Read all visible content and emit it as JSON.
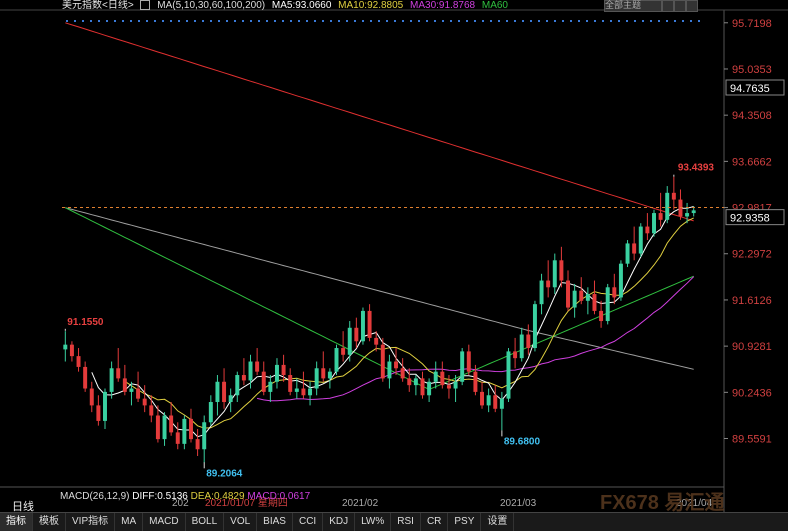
{
  "header": {
    "symbol": "美元指数<日线>",
    "ma_params": "MA(5,10,30,60,100,200)",
    "ma5": "MA5:93.0660",
    "ma10": "MA10:92.8805",
    "ma30": "MA30:91.8768",
    "ma60": "MA60",
    "main_menu": "全部主题"
  },
  "colors": {
    "up": "#3ad0a0",
    "down": "#e43b3b",
    "ma5": "#ffffff",
    "ma10": "#e0d040",
    "ma30": "#d040e0",
    "ma60": "#30c040",
    "ma100": "#a0a0a0",
    "ma200": "#e03030",
    "axis_text": "#d04040"
  },
  "macd": {
    "label": "MACD(26,12,9)",
    "diff": "DIFF:0.5136",
    "dea": "DEA:0.4829",
    "macd": "MACD:0.0617"
  },
  "daily_label": "日线",
  "bottom_tabs": [
    "指标",
    "模板",
    "VIP指标",
    "MA",
    "MACD",
    "BOLL",
    "VOL",
    "BIAS",
    "CCI",
    "KDJ",
    "LW%",
    "RSI",
    "CR",
    "PSY",
    "设置"
  ],
  "watermark": "FX678 易汇通",
  "chart_data": {
    "type": "candlestick",
    "y_ticks": [
      95.7198,
      95.0353,
      94.3508,
      93.6662,
      92.9817,
      92.2972,
      91.6126,
      90.9281,
      90.2436,
      89.5591
    ],
    "y_range": [
      89.3,
      95.85
    ],
    "x_labels": [
      "202",
      "2021/01/07 星期四",
      "2021/02",
      "2021/03",
      "2021/04"
    ],
    "current_price": "92.9358",
    "crosshair_price": "94.7635",
    "annotations": [
      {
        "text": "91.1550",
        "index": 0,
        "price": 91.155
      },
      {
        "text": "89.2064",
        "index": 21,
        "price": 89.2064
      },
      {
        "text": "89.6800",
        "index": 66,
        "price": 89.68
      },
      {
        "text": "93.4393",
        "index": 92,
        "price": 93.4393
      }
    ],
    "candles": [
      {
        "o": 90.88,
        "h": 91.15,
        "l": 90.7,
        "c": 90.95
      },
      {
        "o": 90.95,
        "h": 91.0,
        "l": 90.7,
        "c": 90.78
      },
      {
        "o": 90.78,
        "h": 90.9,
        "l": 90.55,
        "c": 90.62
      },
      {
        "o": 90.62,
        "h": 90.7,
        "l": 90.25,
        "c": 90.3
      },
      {
        "o": 90.3,
        "h": 90.4,
        "l": 89.95,
        "c": 90.05
      },
      {
        "o": 90.05,
        "h": 90.2,
        "l": 89.75,
        "c": 89.82
      },
      {
        "o": 89.82,
        "h": 90.3,
        "l": 89.7,
        "c": 90.25
      },
      {
        "o": 90.25,
        "h": 90.7,
        "l": 90.15,
        "c": 90.6
      },
      {
        "o": 90.6,
        "h": 90.9,
        "l": 90.4,
        "c": 90.45
      },
      {
        "o": 90.45,
        "h": 90.65,
        "l": 90.2,
        "c": 90.25
      },
      {
        "o": 90.25,
        "h": 90.4,
        "l": 90.05,
        "c": 90.3
      },
      {
        "o": 90.3,
        "h": 90.55,
        "l": 90.1,
        "c": 90.15
      },
      {
        "o": 90.15,
        "h": 90.35,
        "l": 89.95,
        "c": 90.05
      },
      {
        "o": 90.05,
        "h": 90.2,
        "l": 89.8,
        "c": 89.9
      },
      {
        "o": 89.9,
        "h": 90.05,
        "l": 89.5,
        "c": 89.55
      },
      {
        "o": 89.55,
        "h": 89.95,
        "l": 89.45,
        "c": 89.9
      },
      {
        "o": 89.9,
        "h": 90.1,
        "l": 89.6,
        "c": 89.65
      },
      {
        "o": 89.65,
        "h": 89.8,
        "l": 89.4,
        "c": 89.48
      },
      {
        "o": 89.48,
        "h": 89.9,
        "l": 89.4,
        "c": 89.85
      },
      {
        "o": 89.85,
        "h": 90.0,
        "l": 89.5,
        "c": 89.55
      },
      {
        "o": 89.55,
        "h": 89.7,
        "l": 89.3,
        "c": 89.4
      },
      {
        "o": 89.4,
        "h": 89.9,
        "l": 89.2,
        "c": 89.8
      },
      {
        "o": 89.8,
        "h": 90.2,
        "l": 89.75,
        "c": 90.1
      },
      {
        "o": 90.1,
        "h": 90.5,
        "l": 89.9,
        "c": 90.4
      },
      {
        "o": 90.4,
        "h": 90.6,
        "l": 90.0,
        "c": 90.1
      },
      {
        "o": 90.1,
        "h": 90.3,
        "l": 89.95,
        "c": 90.2
      },
      {
        "o": 90.2,
        "h": 90.55,
        "l": 90.1,
        "c": 90.5
      },
      {
        "o": 90.5,
        "h": 90.75,
        "l": 90.35,
        "c": 90.42
      },
      {
        "o": 90.42,
        "h": 90.8,
        "l": 90.3,
        "c": 90.7
      },
      {
        "o": 90.7,
        "h": 90.9,
        "l": 90.5,
        "c": 90.55
      },
      {
        "o": 90.55,
        "h": 90.7,
        "l": 90.2,
        "c": 90.25
      },
      {
        "o": 90.25,
        "h": 90.5,
        "l": 90.1,
        "c": 90.4
      },
      {
        "o": 90.4,
        "h": 90.75,
        "l": 90.3,
        "c": 90.65
      },
      {
        "o": 90.65,
        "h": 90.8,
        "l": 90.4,
        "c": 90.5
      },
      {
        "o": 90.5,
        "h": 90.6,
        "l": 90.2,
        "c": 90.25
      },
      {
        "o": 90.25,
        "h": 90.45,
        "l": 90.15,
        "c": 90.3
      },
      {
        "o": 90.3,
        "h": 90.55,
        "l": 90.15,
        "c": 90.2
      },
      {
        "o": 90.2,
        "h": 90.4,
        "l": 90.05,
        "c": 90.3
      },
      {
        "o": 90.3,
        "h": 90.7,
        "l": 90.2,
        "c": 90.6
      },
      {
        "o": 90.6,
        "h": 90.85,
        "l": 90.4,
        "c": 90.45
      },
      {
        "o": 90.45,
        "h": 90.6,
        "l": 90.3,
        "c": 90.55
      },
      {
        "o": 90.55,
        "h": 90.95,
        "l": 90.5,
        "c": 90.9
      },
      {
        "o": 90.9,
        "h": 91.15,
        "l": 90.7,
        "c": 90.8
      },
      {
        "o": 90.8,
        "h": 91.3,
        "l": 90.7,
        "c": 91.2
      },
      {
        "o": 91.2,
        "h": 91.35,
        "l": 90.9,
        "c": 91.0
      },
      {
        "o": 91.0,
        "h": 91.5,
        "l": 90.95,
        "c": 91.45
      },
      {
        "o": 91.45,
        "h": 91.55,
        "l": 91.0,
        "c": 91.05
      },
      {
        "o": 91.05,
        "h": 91.15,
        "l": 90.85,
        "c": 90.95
      },
      {
        "o": 90.95,
        "h": 91.05,
        "l": 90.4,
        "c": 90.45
      },
      {
        "o": 90.45,
        "h": 90.8,
        "l": 90.3,
        "c": 90.7
      },
      {
        "o": 90.7,
        "h": 90.9,
        "l": 90.5,
        "c": 90.6
      },
      {
        "o": 90.6,
        "h": 90.75,
        "l": 90.4,
        "c": 90.45
      },
      {
        "o": 90.45,
        "h": 90.6,
        "l": 90.25,
        "c": 90.35
      },
      {
        "o": 90.35,
        "h": 90.5,
        "l": 90.2,
        "c": 90.45
      },
      {
        "o": 90.45,
        "h": 90.55,
        "l": 90.15,
        "c": 90.2
      },
      {
        "o": 90.2,
        "h": 90.45,
        "l": 90.1,
        "c": 90.4
      },
      {
        "o": 90.4,
        "h": 90.7,
        "l": 90.3,
        "c": 90.55
      },
      {
        "o": 90.55,
        "h": 90.7,
        "l": 90.3,
        "c": 90.35
      },
      {
        "o": 90.35,
        "h": 90.5,
        "l": 90.15,
        "c": 90.3
      },
      {
        "o": 90.3,
        "h": 90.5,
        "l": 90.1,
        "c": 90.4
      },
      {
        "o": 90.4,
        "h": 90.9,
        "l": 90.35,
        "c": 90.85
      },
      {
        "o": 90.85,
        "h": 90.95,
        "l": 90.5,
        "c": 90.55
      },
      {
        "o": 90.55,
        "h": 90.65,
        "l": 90.2,
        "c": 90.25
      },
      {
        "o": 90.25,
        "h": 90.4,
        "l": 90.0,
        "c": 90.05
      },
      {
        "o": 90.05,
        "h": 90.3,
        "l": 89.95,
        "c": 90.2
      },
      {
        "o": 90.2,
        "h": 90.35,
        "l": 89.95,
        "c": 90.0
      },
      {
        "o": 90.0,
        "h": 90.25,
        "l": 89.68,
        "c": 90.15
      },
      {
        "o": 90.15,
        "h": 90.9,
        "l": 90.1,
        "c": 90.85
      },
      {
        "o": 90.85,
        "h": 91.05,
        "l": 90.6,
        "c": 90.75
      },
      {
        "o": 90.75,
        "h": 91.2,
        "l": 90.7,
        "c": 91.1
      },
      {
        "o": 91.1,
        "h": 91.25,
        "l": 90.8,
        "c": 90.9
      },
      {
        "o": 90.9,
        "h": 91.6,
        "l": 90.85,
        "c": 91.55
      },
      {
        "o": 91.55,
        "h": 92.0,
        "l": 91.4,
        "c": 91.9
      },
      {
        "o": 91.9,
        "h": 92.2,
        "l": 91.65,
        "c": 91.8
      },
      {
        "o": 91.8,
        "h": 92.3,
        "l": 91.7,
        "c": 92.2
      },
      {
        "o": 92.2,
        "h": 92.4,
        "l": 91.8,
        "c": 91.9
      },
      {
        "o": 91.9,
        "h": 92.05,
        "l": 91.45,
        "c": 91.5
      },
      {
        "o": 91.5,
        "h": 91.85,
        "l": 91.35,
        "c": 91.75
      },
      {
        "o": 91.75,
        "h": 91.95,
        "l": 91.55,
        "c": 91.6
      },
      {
        "o": 91.6,
        "h": 91.8,
        "l": 91.4,
        "c": 91.7
      },
      {
        "o": 91.7,
        "h": 91.9,
        "l": 91.4,
        "c": 91.45
      },
      {
        "o": 91.45,
        "h": 91.6,
        "l": 91.2,
        "c": 91.3
      },
      {
        "o": 91.3,
        "h": 91.85,
        "l": 91.25,
        "c": 91.8
      },
      {
        "o": 91.8,
        "h": 92.0,
        "l": 91.55,
        "c": 91.65
      },
      {
        "o": 91.65,
        "h": 92.2,
        "l": 91.6,
        "c": 92.15
      },
      {
        "o": 92.15,
        "h": 92.5,
        "l": 92.1,
        "c": 92.45
      },
      {
        "o": 92.45,
        "h": 92.7,
        "l": 92.2,
        "c": 92.3
      },
      {
        "o": 92.3,
        "h": 92.75,
        "l": 92.25,
        "c": 92.7
      },
      {
        "o": 92.7,
        "h": 92.9,
        "l": 92.5,
        "c": 92.6
      },
      {
        "o": 92.6,
        "h": 92.95,
        "l": 92.55,
        "c": 92.9
      },
      {
        "o": 92.9,
        "h": 93.2,
        "l": 92.7,
        "c": 92.8
      },
      {
        "o": 92.8,
        "h": 93.3,
        "l": 92.75,
        "c": 93.2
      },
      {
        "o": 93.2,
        "h": 93.44,
        "l": 92.95,
        "c": 93.1
      },
      {
        "o": 93.1,
        "h": 93.25,
        "l": 92.8,
        "c": 92.85
      },
      {
        "o": 92.85,
        "h": 93.05,
        "l": 92.75,
        "c": 92.9
      },
      {
        "o": 92.9,
        "h": 93.0,
        "l": 92.85,
        "c": 92.94
      }
    ]
  }
}
